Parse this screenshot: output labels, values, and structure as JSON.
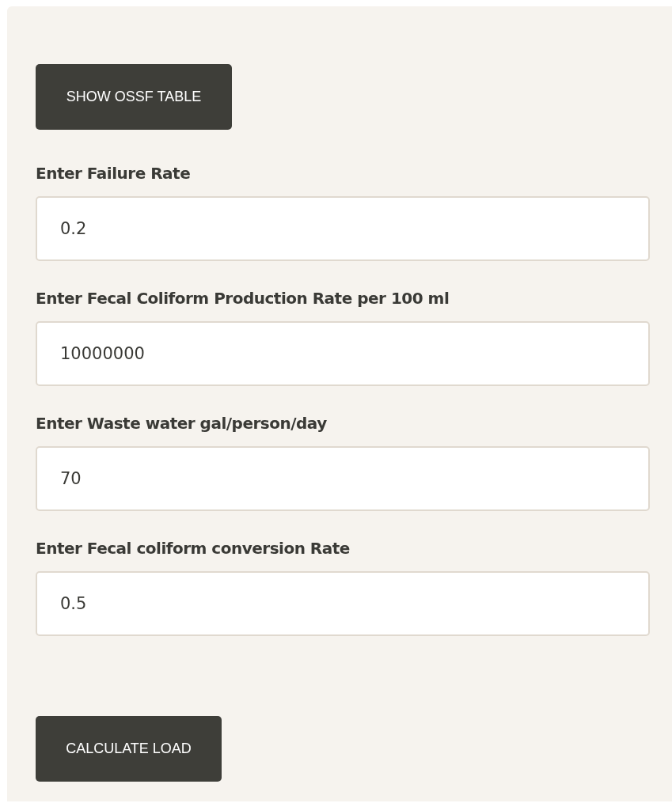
{
  "table_button": {
    "label": "SHOW OSSF TABLE"
  },
  "fields": [
    {
      "label": "Enter Failure Rate",
      "value": "0.2"
    },
    {
      "label": "Enter Fecal Coliform Production Rate per 100 ml",
      "value": "10000000"
    },
    {
      "label": "Enter Waste water gal/person/day",
      "value": "70"
    },
    {
      "label": "Enter Fecal coliform conversion Rate",
      "value": "0.5"
    }
  ],
  "calculate_button": {
    "label": "CALCULATE LOAD"
  }
}
